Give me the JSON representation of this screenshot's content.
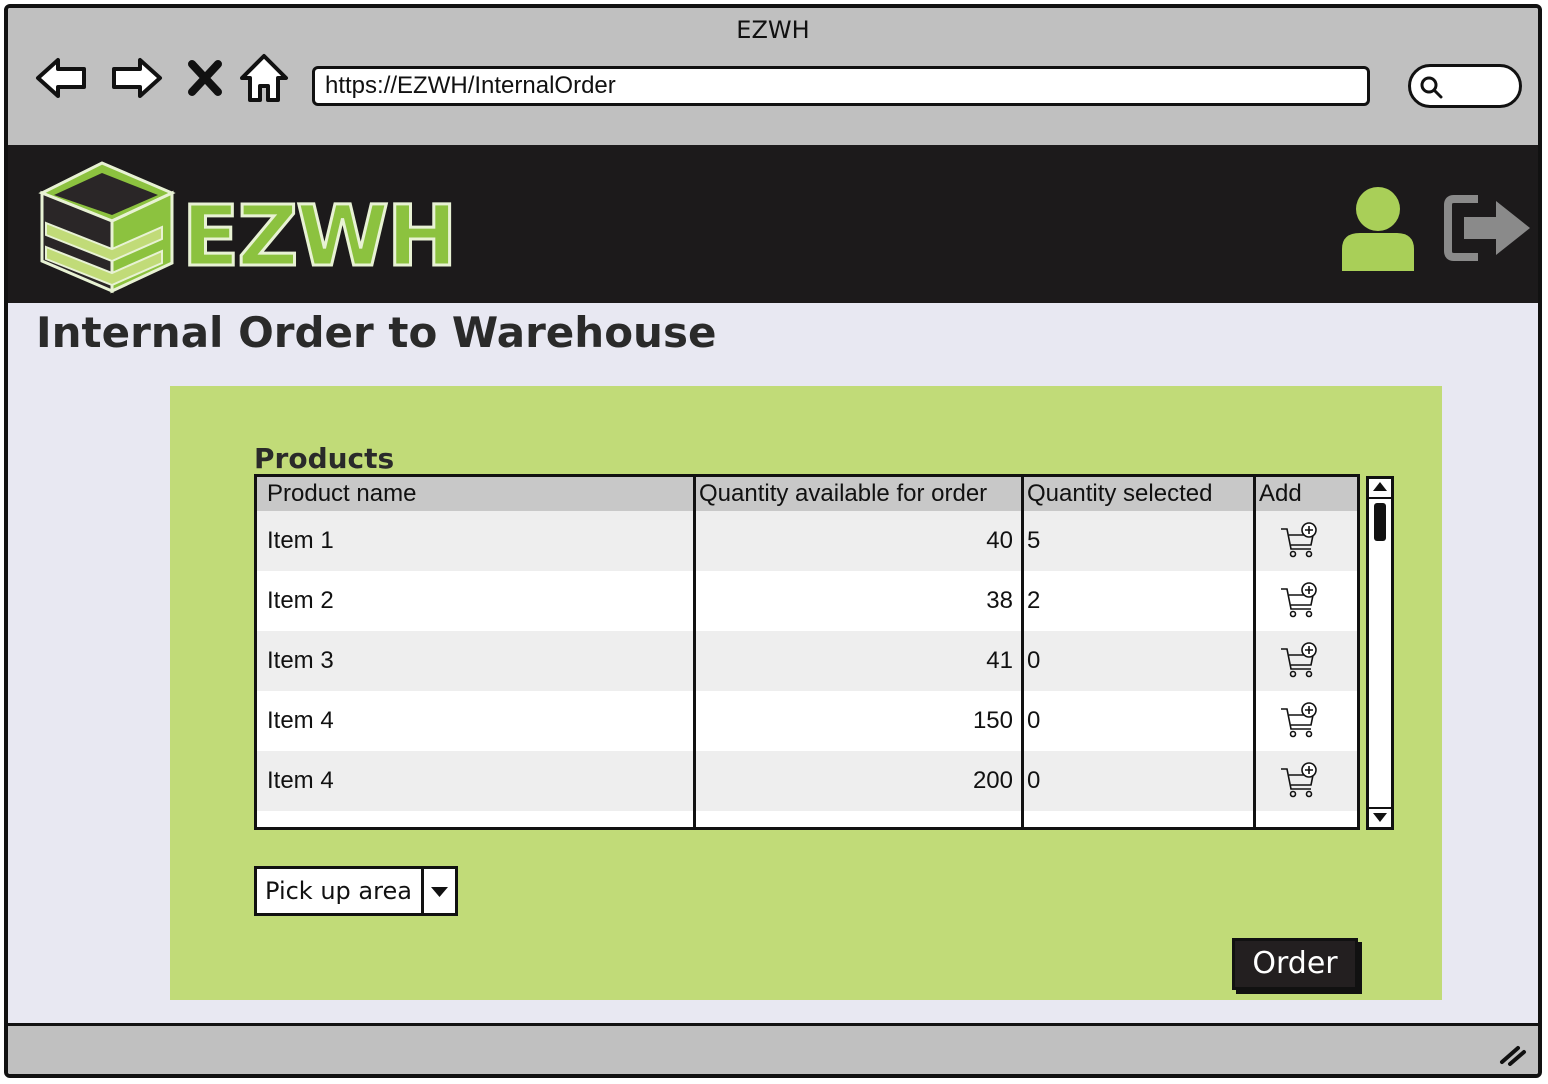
{
  "browser": {
    "window_title": "EZWH",
    "url": "https://EZWH/InternalOrder",
    "icons": [
      "back-icon",
      "forward-icon",
      "close-icon",
      "home-icon",
      "search-icon"
    ]
  },
  "header": {
    "logo_text": "EZWH",
    "brand_color": "#8cc23f",
    "icons": [
      "user-icon",
      "logout-icon"
    ]
  },
  "page": {
    "title": "Internal Order to Warehouse"
  },
  "products": {
    "label": "Products",
    "columns": [
      "Product name",
      "Quantity available for order",
      "Quantity selected",
      "Add"
    ],
    "rows": [
      {
        "name": "Item 1",
        "available": "40",
        "selected": "5"
      },
      {
        "name": "Item 2",
        "available": "38",
        "selected": "2"
      },
      {
        "name": "Item 3",
        "available": "41",
        "selected": "0"
      },
      {
        "name": "Item 4",
        "available": "150",
        "selected": "0"
      },
      {
        "name": "Item 4",
        "available": "200",
        "selected": "0"
      }
    ]
  },
  "pickup": {
    "selected": "Pick up area"
  },
  "actions": {
    "order_label": "Order"
  },
  "colors": {
    "panel": "#c1db78",
    "header_bg": "#1c1a1b",
    "page_bg": "#e8e8f2"
  }
}
